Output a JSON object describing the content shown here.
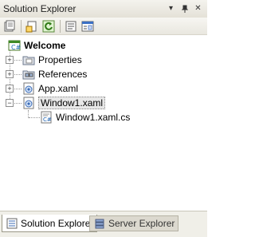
{
  "window": {
    "title": "Solution Explorer"
  },
  "title_buttons": {
    "dropdown": "▾",
    "pin": "ᵖ",
    "close": "✕"
  },
  "toolbar": {
    "icons": [
      "properties-icon",
      "show-all-files-icon",
      "refresh-icon",
      "view-code-icon",
      "view-designer-icon"
    ]
  },
  "tree": {
    "root": "Welcome",
    "items": [
      {
        "label": "Properties",
        "expander": "+"
      },
      {
        "label": "References",
        "expander": "+"
      },
      {
        "label": "App.xaml",
        "expander": "+"
      },
      {
        "label": "Window1.xaml",
        "expander": "−"
      },
      {
        "label": "Window1.xaml.cs"
      }
    ]
  },
  "tabs": [
    {
      "label": "Solution Explorer",
      "active": true
    },
    {
      "label": "Server Explorer",
      "active": false
    }
  ],
  "colors": {
    "accent": "#316ac5",
    "panel_bg": "#ffffff",
    "chrome": "#ece9d8"
  }
}
